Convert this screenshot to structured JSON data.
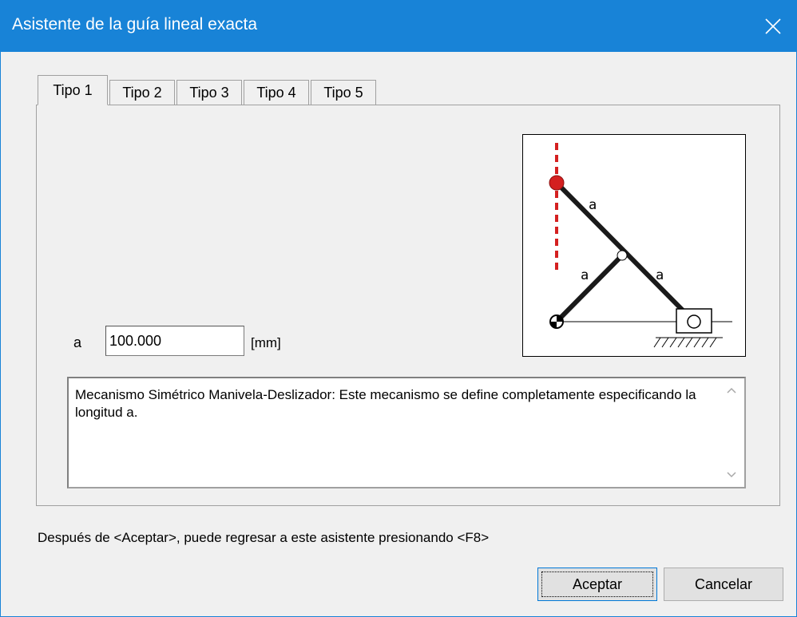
{
  "window": {
    "title": "Asistente de la guía lineal exacta",
    "accent_color": "#1883d7",
    "close_icon": "close-icon"
  },
  "tabs": [
    {
      "label": "Tipo 1",
      "active": true
    },
    {
      "label": "Tipo 2",
      "active": false
    },
    {
      "label": "Tipo 3",
      "active": false
    },
    {
      "label": "Tipo 4",
      "active": false
    },
    {
      "label": "Tipo 5",
      "active": false
    }
  ],
  "form": {
    "a_label": "a",
    "a_value": "100.000",
    "a_unit": "[mm]"
  },
  "diagram": {
    "link_labels": [
      "a",
      "a",
      "a"
    ],
    "trace_color": "#d42020"
  },
  "description": {
    "text": "Mecanismo Simétrico Manivela-Deslizador: Este mecanismo se define completamente especificando la longitud a."
  },
  "footer": {
    "note": "Después de <Aceptar>, puede regresar a este asistente presionando <F8>",
    "ok_label": "Aceptar",
    "cancel_label": "Cancelar"
  }
}
